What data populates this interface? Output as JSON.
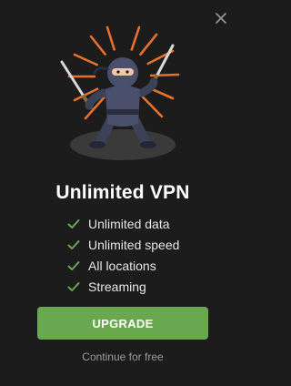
{
  "popup": {
    "title": "Unlimited VPN",
    "features": [
      {
        "label": "Unlimited data"
      },
      {
        "label": "Unlimited speed"
      },
      {
        "label": "All locations"
      },
      {
        "label": "Streaming"
      }
    ],
    "upgrade_label": "UPGRADE",
    "continue_label": "Continue for free"
  },
  "icons": {
    "close": "close-icon",
    "check": "check-icon",
    "hero": "ninja-illustration"
  },
  "colors": {
    "background": "#1c1c1c",
    "accent": "#6aa84f",
    "burst": "#e8702a",
    "muted_text": "#9a9a9a"
  }
}
